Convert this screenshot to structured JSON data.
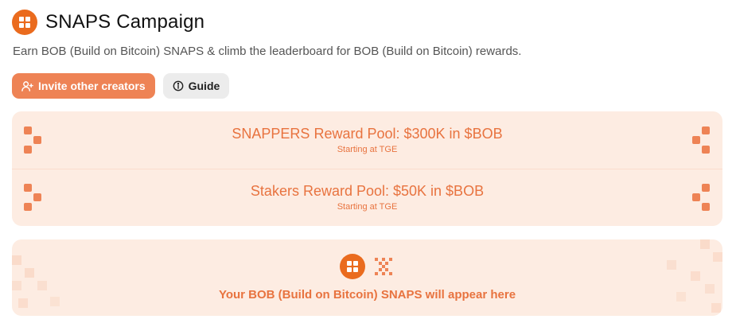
{
  "header": {
    "title": "SNAPS Campaign",
    "logo_icon": "grid-logo-icon"
  },
  "subtitle": "Earn BOB (Build on Bitcoin) SNAPS & climb the leaderboard for BOB (Build on Bitcoin) rewards.",
  "actions": {
    "invite_label": "Invite other creators",
    "guide_label": "Guide"
  },
  "pools": [
    {
      "title": "SNAPPERS Reward Pool: $300K in $BOB",
      "subtitle": "Starting at TGE"
    },
    {
      "title": "Stakers Reward Pool: $50K in $BOB",
      "subtitle": "Starting at TGE"
    }
  ],
  "snaps": {
    "empty_message": "Your BOB (Build on Bitcoin) SNAPS will appear here"
  },
  "colors": {
    "accent": "#ea6b1e",
    "accent_text": "#e8733f",
    "panel_bg": "#fdece2",
    "button_primary": "#ee8355"
  }
}
